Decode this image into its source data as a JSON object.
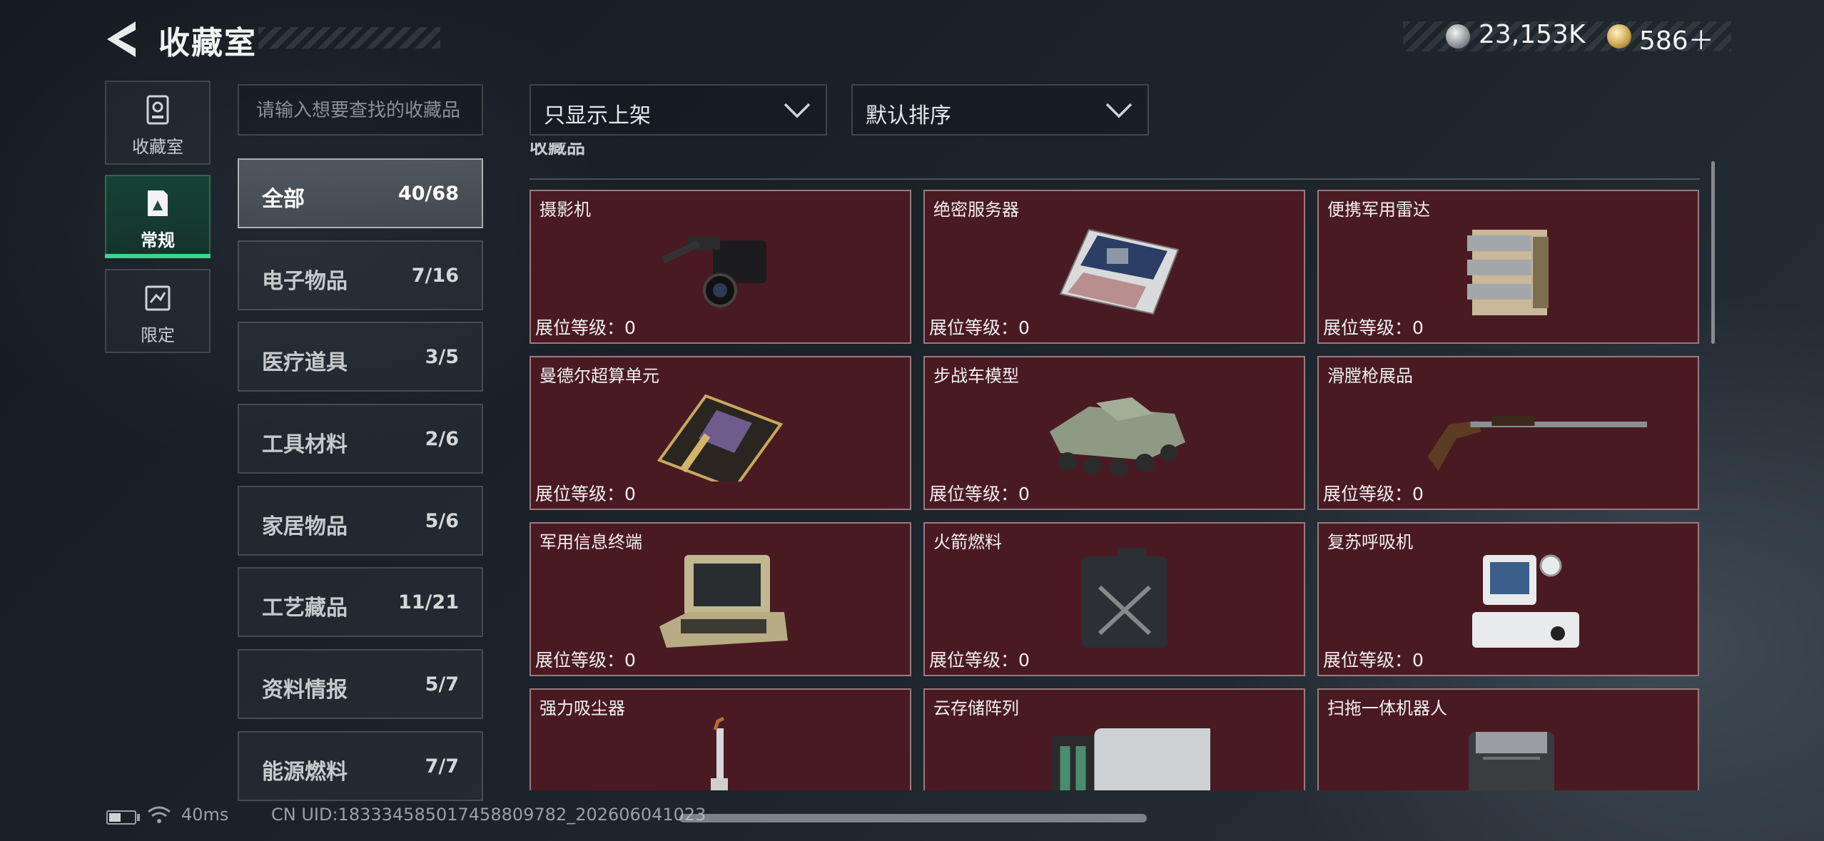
{
  "header": {
    "title": "收藏室",
    "currencies": {
      "silver": "23,153K",
      "gold": "586＋"
    }
  },
  "nav": [
    {
      "label": "收藏室",
      "icon": "collection-room-icon",
      "active": false
    },
    {
      "label": "常规",
      "icon": "regular-doc-icon",
      "active": true
    },
    {
      "label": "限定",
      "icon": "limited-icon",
      "active": false
    }
  ],
  "search": {
    "placeholder": "请输入想要查找的收藏品",
    "value": ""
  },
  "filters": {
    "display": "只显示上架",
    "sort": "默认排序"
  },
  "categories": [
    {
      "label": "全部",
      "count": "40/68",
      "active": true
    },
    {
      "label": "电子物品",
      "count": "7/16"
    },
    {
      "label": "医疗道具",
      "count": "3/5"
    },
    {
      "label": "工具材料",
      "count": "2/6"
    },
    {
      "label": "家居物品",
      "count": "5/6"
    },
    {
      "label": "工艺藏品",
      "count": "11/21"
    },
    {
      "label": "资料情报",
      "count": "5/7"
    },
    {
      "label": "能源燃料",
      "count": "7/7"
    }
  ],
  "grid": {
    "section_title": "收藏品",
    "level_label": "展位等级：",
    "items": [
      {
        "name": "摄影机",
        "level": "0",
        "icon": "camera-icon"
      },
      {
        "name": "绝密服务器",
        "level": "0",
        "icon": "server-icon"
      },
      {
        "name": "便携军用雷达",
        "level": "0",
        "icon": "radar-icon"
      },
      {
        "name": "曼德尔超算单元",
        "level": "0",
        "icon": "supercomputer-unit-icon"
      },
      {
        "name": "步战车模型",
        "level": "0",
        "icon": "ifv-model-icon"
      },
      {
        "name": "滑膛枪展品",
        "level": "0",
        "icon": "musket-icon"
      },
      {
        "name": "军用信息终端",
        "level": "0",
        "icon": "military-terminal-icon"
      },
      {
        "name": "火箭燃料",
        "level": "0",
        "icon": "fuel-can-icon"
      },
      {
        "name": "复苏呼吸机",
        "level": "0",
        "icon": "ventilator-icon"
      },
      {
        "name": "强力吸尘器",
        "level": "",
        "icon": "vacuum-icon"
      },
      {
        "name": "云存储阵列",
        "level": "",
        "icon": "storage-array-icon"
      },
      {
        "name": "扫拖一体机器人",
        "level": "",
        "icon": "mop-robot-icon"
      }
    ]
  },
  "footer": {
    "latency": "40ms",
    "uid": "CN UID:18333458501745880978​2_202606041023"
  },
  "colors": {
    "card_bg": "#4a1a23",
    "active_nav": "#3fd48c",
    "page_bg": "#1b2229"
  }
}
